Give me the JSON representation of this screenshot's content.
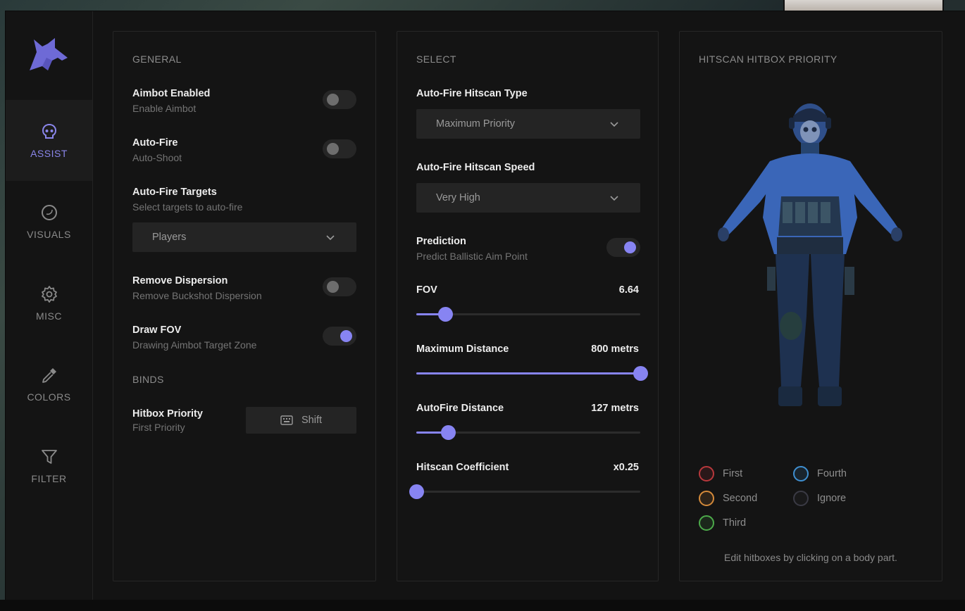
{
  "sidebar": {
    "items": [
      {
        "id": "assist",
        "label": "ASSIST",
        "icon": "skull-icon",
        "active": true
      },
      {
        "id": "visuals",
        "label": "VISUALS",
        "icon": "moon-icon",
        "active": false
      },
      {
        "id": "misc",
        "label": "MISC",
        "icon": "gear-icon",
        "active": false
      },
      {
        "id": "colors",
        "label": "COLORS",
        "icon": "eyedropper-icon",
        "active": false
      },
      {
        "id": "filter",
        "label": "FILTER",
        "icon": "filter-icon",
        "active": false
      }
    ]
  },
  "general": {
    "title": "GENERAL",
    "aimbot": {
      "title": "Aimbot Enabled",
      "sub": "Enable Aimbot",
      "on": false
    },
    "autofire": {
      "title": "Auto-Fire",
      "sub": "Auto-Shoot",
      "on": false
    },
    "targets": {
      "title": "Auto-Fire Targets",
      "sub": "Select targets to auto-fire",
      "value": "Players"
    },
    "dispersion": {
      "title": "Remove Dispersion",
      "sub": "Remove Buckshot Dispersion",
      "on": false
    },
    "drawfov": {
      "title": "Draw FOV",
      "sub": "Drawing Aimbot Target Zone",
      "on": true
    },
    "binds_title": "BINDS",
    "hitbox": {
      "title": "Hitbox Priority",
      "sub": "First Priority",
      "key": "Shift"
    }
  },
  "select": {
    "title": "SELECT",
    "type": {
      "title": "Auto-Fire Hitscan Type",
      "value": "Maximum Priority"
    },
    "speed": {
      "title": "Auto-Fire Hitscan Speed",
      "value": "Very High"
    },
    "prediction": {
      "title": "Prediction",
      "sub": "Predict Ballistic Aim Point",
      "on": true
    },
    "sliders": [
      {
        "label": "FOV",
        "value": "6.64",
        "fraction": 0.13
      },
      {
        "label": "Maximum Distance",
        "value": "800 metrs",
        "fraction": 1.0
      },
      {
        "label": "AutoFire Distance",
        "value": "127 metrs",
        "fraction": 0.14
      },
      {
        "label": "Hitscan Coefficient",
        "value": "x0.25",
        "fraction": 0.0
      }
    ]
  },
  "hitscan": {
    "title": "HITSCAN HITBOX PRIORITY",
    "legend": [
      {
        "label": "First",
        "color": "#b8383c"
      },
      {
        "label": "Fourth",
        "color": "#3f8fd0"
      },
      {
        "label": "Second",
        "color": "#d48a3a"
      },
      {
        "label": "Ignore",
        "color": "#3a3a44"
      },
      {
        "label": "Third",
        "color": "#4caa4a"
      }
    ],
    "hint": "Edit hitboxes by clicking on a body part."
  },
  "colors": {
    "accent": "#8784f2",
    "panel": "#141414",
    "bg": "#131313"
  }
}
